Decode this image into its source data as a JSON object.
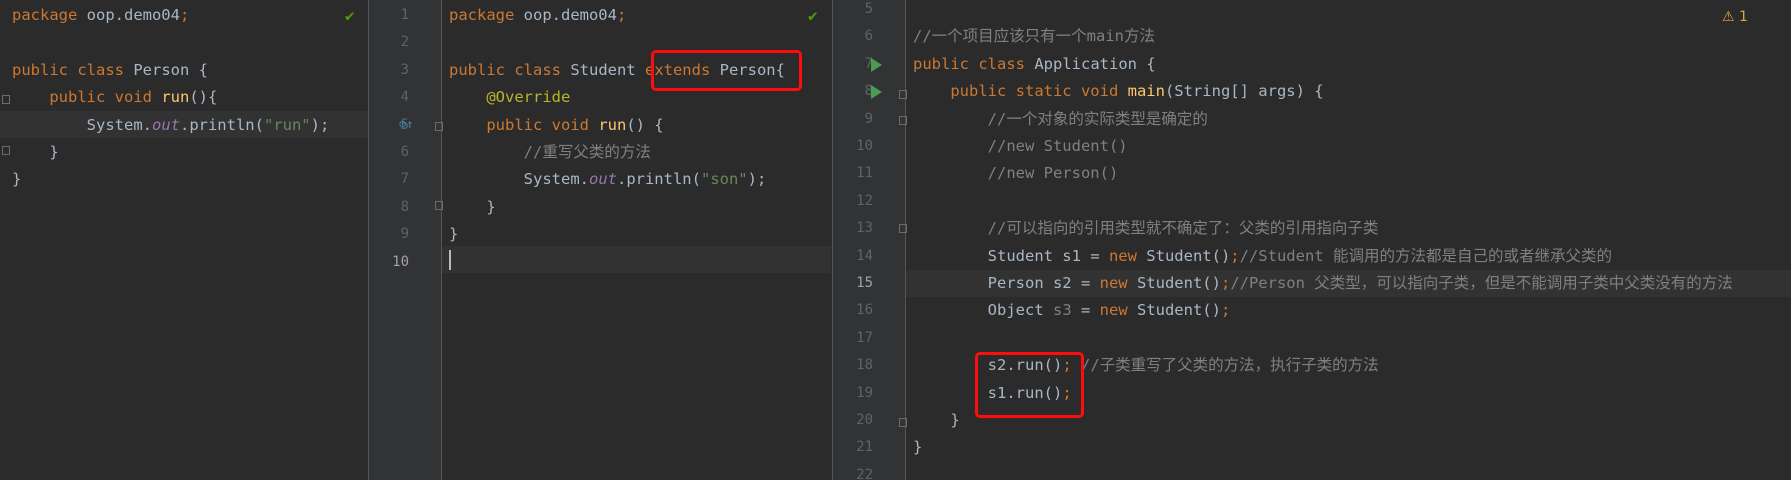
{
  "pane1": {
    "lines": [
      [
        {
          "t": "package ",
          "c": "kw"
        },
        {
          "t": "oop.demo04",
          "c": ""
        },
        {
          "t": ";",
          "c": "kw"
        }
      ],
      [],
      [
        {
          "t": "public class ",
          "c": "kw"
        },
        {
          "t": "Person {",
          "c": ""
        }
      ],
      [
        {
          "t": "    public void ",
          "c": "kw"
        },
        {
          "t": "run",
          "c": "fn"
        },
        {
          "t": "(){",
          "c": ""
        }
      ],
      [
        {
          "t": "        System.",
          "c": ""
        },
        {
          "t": "out",
          "c": "it"
        },
        {
          "t": ".println(",
          "c": ""
        },
        {
          "t": "\"run\"",
          "c": "st"
        },
        {
          "t": ");",
          "c": ""
        }
      ],
      [
        {
          "t": "    }",
          "c": ""
        }
      ],
      [
        {
          "t": "}",
          "c": ""
        }
      ]
    ]
  },
  "pane2": {
    "line_numbers": [
      "1",
      "2",
      "3",
      "4",
      "5",
      "6",
      "7",
      "8",
      "9",
      "10"
    ],
    "lines": [
      [
        {
          "t": "package ",
          "c": "kw"
        },
        {
          "t": "oop.demo04",
          "c": ""
        },
        {
          "t": ";",
          "c": "kw"
        }
      ],
      [],
      [
        {
          "t": "public class ",
          "c": "kw"
        },
        {
          "t": "Student ",
          "c": ""
        },
        {
          "t": "extends ",
          "c": "kw"
        },
        {
          "t": "Person{",
          "c": ""
        }
      ],
      [
        {
          "t": "    ",
          "c": ""
        },
        {
          "t": "@Override",
          "c": "an"
        }
      ],
      [
        {
          "t": "    public void ",
          "c": "kw"
        },
        {
          "t": "run",
          "c": "fn"
        },
        {
          "t": "() {",
          "c": ""
        }
      ],
      [
        {
          "t": "        //重写父类的方法",
          "c": "cm"
        }
      ],
      [
        {
          "t": "        System.",
          "c": ""
        },
        {
          "t": "out",
          "c": "it"
        },
        {
          "t": ".println(",
          "c": ""
        },
        {
          "t": "\"son\"",
          "c": "st"
        },
        {
          "t": ");",
          "c": ""
        }
      ],
      [
        {
          "t": "    }",
          "c": ""
        }
      ],
      [
        {
          "t": "}",
          "c": ""
        }
      ],
      []
    ]
  },
  "pane3": {
    "line_numbers": [
      "5",
      "6",
      "7",
      "8",
      "9",
      "10",
      "11",
      "12",
      "13",
      "14",
      "15",
      "16",
      "17",
      "18",
      "19",
      "20",
      "21",
      "22"
    ],
    "warning_count": "1",
    "lines": [
      [],
      [
        {
          "t": "//一个项目应该只有一个main方法",
          "c": "cm"
        }
      ],
      [
        {
          "t": "public class ",
          "c": "kw"
        },
        {
          "t": "Application {",
          "c": ""
        }
      ],
      [
        {
          "t": "    public static void ",
          "c": "kw"
        },
        {
          "t": "main",
          "c": "fn"
        },
        {
          "t": "(String[] args) {",
          "c": ""
        }
      ],
      [
        {
          "t": "        //一个对象的实际类型是确定的",
          "c": "cm"
        }
      ],
      [
        {
          "t": "        //new Student()",
          "c": "cm"
        }
      ],
      [
        {
          "t": "        //new Person()",
          "c": "cm"
        }
      ],
      [],
      [
        {
          "t": "        //可以指向的引用类型就不确定了：父类的引用指向子类",
          "c": "cm"
        }
      ],
      [
        {
          "t": "        Student s1 = ",
          "c": ""
        },
        {
          "t": "new ",
          "c": "kw"
        },
        {
          "t": "Student()",
          "c": ""
        },
        {
          "t": ";",
          "c": "kw"
        },
        {
          "t": "//Student 能调用的方法都是自己的或者继承父类的",
          "c": "cm"
        }
      ],
      [
        {
          "t": "        Person s2 = ",
          "c": ""
        },
        {
          "t": "new ",
          "c": "kw"
        },
        {
          "t": "Student()",
          "c": ""
        },
        {
          "t": ";",
          "c": "kw"
        },
        {
          "t": "//Person 父类型，可以指向子类，但是不能调用子类中父类没有的方法",
          "c": "cm"
        }
      ],
      [
        {
          "t": "        Object ",
          "c": ""
        },
        {
          "t": "s3",
          "c": "cm"
        },
        {
          "t": " = ",
          "c": ""
        },
        {
          "t": "new ",
          "c": "kw"
        },
        {
          "t": "Student()",
          "c": ""
        },
        {
          "t": ";",
          "c": "kw"
        }
      ],
      [],
      [
        {
          "t": "        s2.run()",
          "c": ""
        },
        {
          "t": ";",
          "c": "kw"
        },
        {
          "t": " //子类重写了父类的方法，执行子类的方法",
          "c": "cm"
        }
      ],
      [
        {
          "t": "        s1.run()",
          "c": ""
        },
        {
          "t": ";",
          "c": "kw"
        }
      ],
      [
        {
          "t": "    }",
          "c": ""
        }
      ],
      [
        {
          "t": "}",
          "c": ""
        }
      ],
      []
    ]
  }
}
